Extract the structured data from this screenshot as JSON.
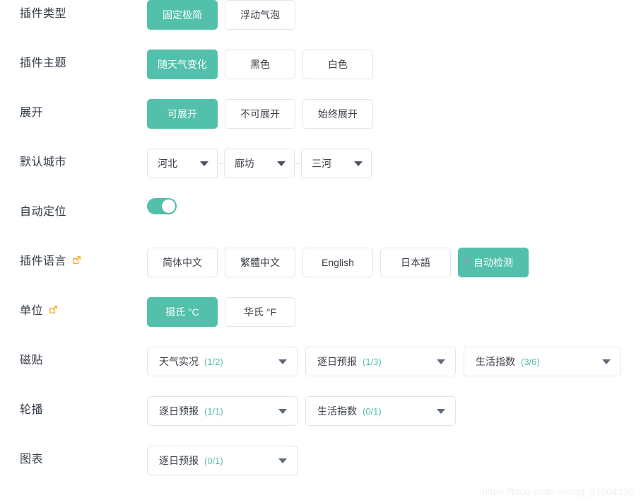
{
  "accent_color": "#53c0ab",
  "border_color": "#e2e6ea",
  "label_color": "#333b47",
  "ext_icon_color": "#f5a623",
  "rows": [
    {
      "key": "plugin_type",
      "label": "插件类型",
      "has_ext_link": false,
      "control": "options",
      "options": [
        {
          "label": "固定极简",
          "selected": true
        },
        {
          "label": "浮动气泡",
          "selected": false
        }
      ]
    },
    {
      "key": "plugin_theme",
      "label": "插件主题",
      "has_ext_link": false,
      "control": "options",
      "options": [
        {
          "label": "随天气变化",
          "selected": true
        },
        {
          "label": "黑色",
          "selected": false
        },
        {
          "label": "白色",
          "selected": false
        }
      ]
    },
    {
      "key": "expand",
      "label": "展开",
      "has_ext_link": false,
      "control": "options",
      "options": [
        {
          "label": "可展开",
          "selected": true
        },
        {
          "label": "不可展开",
          "selected": false
        },
        {
          "label": "始终展开",
          "selected": false
        }
      ]
    },
    {
      "key": "default_city",
      "label": "默认城市",
      "has_ext_link": false,
      "control": "city",
      "selects": [
        {
          "name": "province",
          "value": "河北"
        },
        {
          "name": "city",
          "value": "廊坊"
        },
        {
          "name": "district",
          "value": "三河"
        }
      ]
    },
    {
      "key": "auto_locate",
      "label": "自动定位",
      "has_ext_link": false,
      "control": "toggle",
      "toggle": {
        "on": true
      }
    },
    {
      "key": "plugin_language",
      "label": "插件语言",
      "has_ext_link": true,
      "control": "options",
      "options": [
        {
          "label": "简体中文",
          "selected": false
        },
        {
          "label": "繁體中文",
          "selected": false
        },
        {
          "label": "English",
          "selected": false
        },
        {
          "label": "日本語",
          "selected": false
        },
        {
          "label": "自动检测",
          "selected": true
        }
      ]
    },
    {
      "key": "unit",
      "label": "单位",
      "has_ext_link": true,
      "control": "options",
      "options": [
        {
          "label": "摄氏 °C",
          "selected": true
        },
        {
          "label": "华氏 °F",
          "selected": false
        }
      ]
    },
    {
      "key": "tiles",
      "label": "磁贴",
      "has_ext_link": false,
      "control": "wide",
      "selects": [
        {
          "text": "天气实况",
          "count": "(1/2)",
          "width": "w-213"
        },
        {
          "text": "逐日预报",
          "count": "(1/3)",
          "width": "w-213"
        },
        {
          "text": "生活指数",
          "count": "(3/6)",
          "width": "w-223"
        }
      ]
    },
    {
      "key": "carousel",
      "label": "轮播",
      "has_ext_link": false,
      "control": "wide",
      "selects": [
        {
          "text": "逐日预报",
          "count": "(1/1)",
          "width": "w-213"
        },
        {
          "text": "生活指数",
          "count": "(0/1)",
          "width": "w-213"
        }
      ]
    },
    {
      "key": "chart",
      "label": "图表",
      "has_ext_link": false,
      "control": "wide",
      "selects": [
        {
          "text": "逐日预报",
          "count": "(0/1)",
          "width": "w-213"
        }
      ]
    }
  ],
  "watermark": "https://blog.csdn.net/qq_51604330"
}
